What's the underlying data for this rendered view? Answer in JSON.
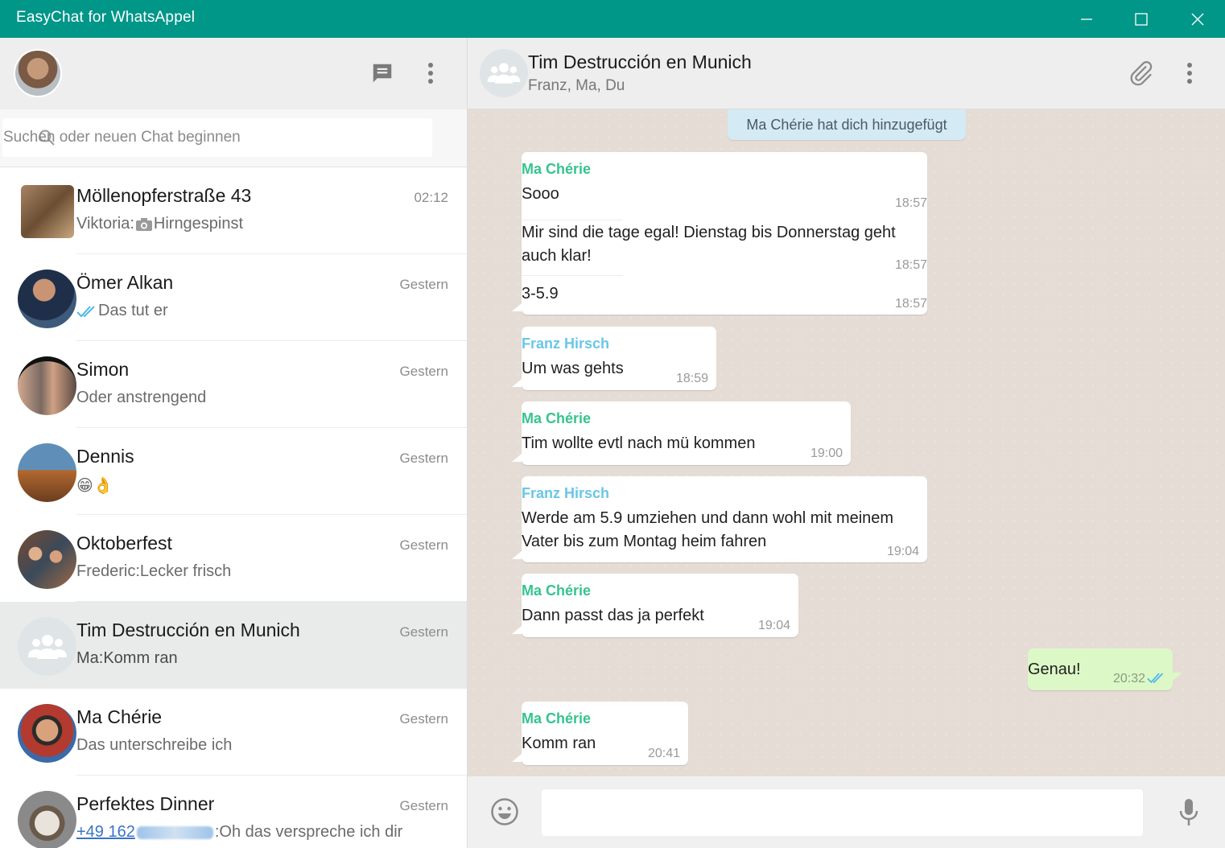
{
  "window": {
    "title": "EasyChat  for WhatsAppel",
    "minimize_icon": "minimize-icon",
    "maximize_icon": "maximize-icon",
    "close_icon": "close-icon",
    "accent_color": "#009688"
  },
  "sidebar": {
    "new_chat_icon": "chat-bubble-icon",
    "menu_icon": "more-vertical-icon",
    "search": {
      "placeholder": "Suchen oder neuen Chat beginnen",
      "value": ""
    },
    "chats": [
      {
        "name": "Möllenopferstraße 43",
        "time": "02:12",
        "preview_prefix": "Viktoria:",
        "preview_icon": "camera-icon",
        "preview": "Hirngespinst"
      },
      {
        "name": "Ömer Alkan",
        "time": "Gestern",
        "preview_icon": "double-check-icon",
        "preview": "Das tut er"
      },
      {
        "name": "Simon",
        "time": "Gestern",
        "preview": "Oder anstrengend"
      },
      {
        "name": "Dennis",
        "time": "Gestern",
        "preview": "😁👌"
      },
      {
        "name": "Oktoberfest",
        "time": "Gestern",
        "preview": "Frederic:Lecker frisch"
      },
      {
        "name": "Tim Destrucción en Munich",
        "time": "Gestern",
        "preview": "Ma:Komm ran",
        "active": true
      },
      {
        "name": "Ma Chérie",
        "time": "Gestern",
        "preview": "Das unterschreibe ich"
      },
      {
        "name": "Perfektes Dinner",
        "time": "Gestern",
        "preview_link": "+49 162",
        "preview": ":Oh das verspreche ich dir"
      }
    ]
  },
  "conversation": {
    "title": "Tim Destrucción en Munich",
    "members": "Franz, Ma, Du",
    "attach_icon": "paperclip-icon",
    "menu_icon": "more-vertical-icon",
    "system_message": "Ma Chérie hat dich hinzugefügt",
    "messages": [
      {
        "sender": "Ma Chérie",
        "parts": [
          {
            "text": "Sooo",
            "time": "18:57"
          },
          {
            "text": "Mir sind die tage egal! Dienstag bis Donnerstag geht auch klar!",
            "time": "18:57"
          },
          {
            "text": "3-5.9",
            "time": "18:57"
          }
        ]
      },
      {
        "sender": "Franz Hirsch",
        "text": "Um was gehts",
        "time": "18:59"
      },
      {
        "sender": "Ma Chérie",
        "text": "Tim wollte evtl nach mü kommen",
        "time": "19:00"
      },
      {
        "sender": "Franz Hirsch",
        "text": "Werde am 5.9 umziehen und dann wohl mit meinem Vater bis zum Montag heim fahren",
        "time": "19:04"
      },
      {
        "sender": "Ma Chérie",
        "text": "Dann passt das ja perfekt",
        "time": "19:04"
      },
      {
        "sender": "Du",
        "text": "Genau!",
        "time": "20:32",
        "outgoing": true,
        "status_icon": "double-check-icon"
      },
      {
        "sender": "Ma Chérie",
        "text": "Komm ran",
        "time": "20:41"
      }
    ],
    "composer": {
      "placeholder": "",
      "emoji_icon": "smiley-icon",
      "mic_icon": "microphone-icon"
    }
  }
}
